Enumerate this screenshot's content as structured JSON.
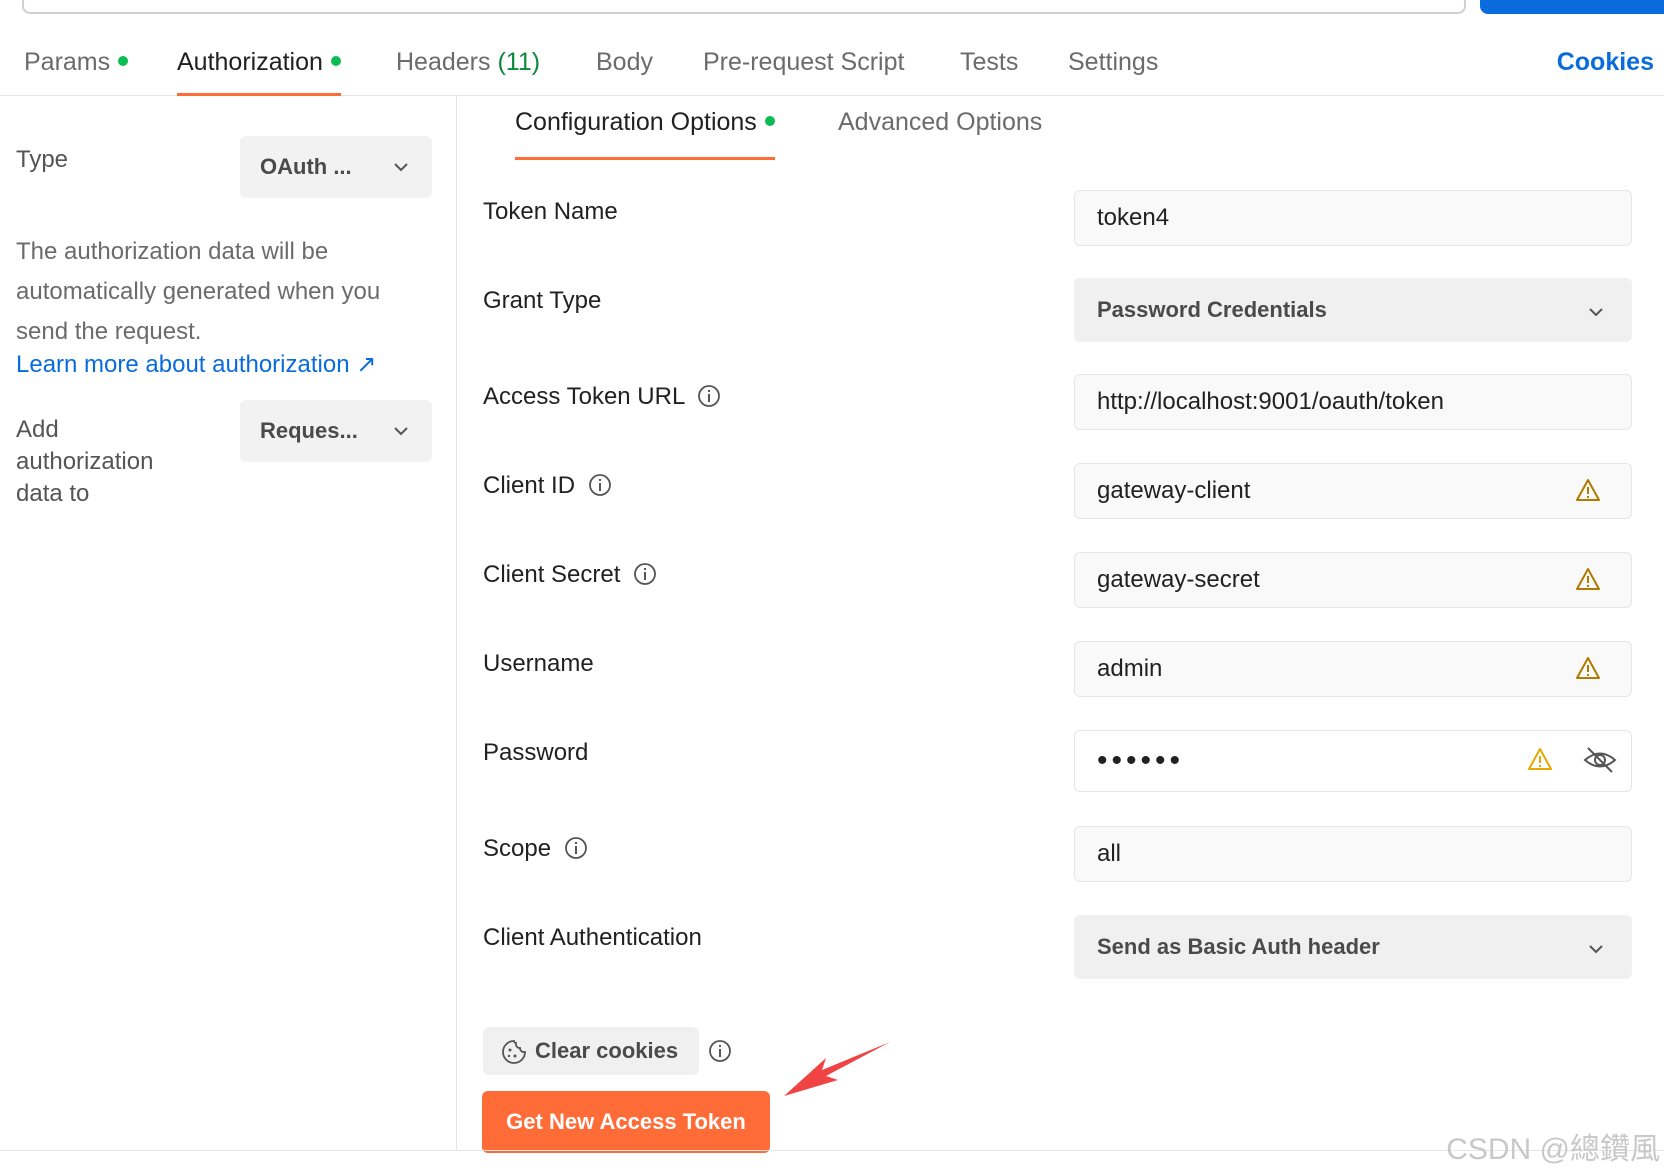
{
  "request_tabs": {
    "params": "Params",
    "authorization": "Authorization",
    "headers": "Headers",
    "headers_count": "(11)",
    "body": "Body",
    "pre_request": "Pre-request Script",
    "tests": "Tests",
    "settings": "Settings",
    "cookies": "Cookies"
  },
  "left": {
    "type_label": "Type",
    "type_value": "OAuth ...",
    "description": "The authorization data will be automatically generated when you send the request.",
    "learn_more": "Learn more about authorization ↗",
    "add_label": "Add authorization data to",
    "add_value": "Reques..."
  },
  "config": {
    "tab_config": "Configuration Options",
    "tab_advanced": "Advanced Options"
  },
  "fields": {
    "token_name": {
      "label": "Token Name",
      "value": "token4"
    },
    "grant_type": {
      "label": "Grant Type",
      "value": "Password Credentials"
    },
    "access_token_url": {
      "label": "Access Token URL",
      "value": "http://localhost:9001/oauth/token"
    },
    "client_id": {
      "label": "Client ID",
      "value": "gateway-client"
    },
    "client_secret": {
      "label": "Client Secret",
      "value": "gateway-secret"
    },
    "username": {
      "label": "Username",
      "value": "admin"
    },
    "password": {
      "label": "Password",
      "value": "••••••"
    },
    "scope": {
      "label": "Scope",
      "value": "all"
    },
    "client_auth": {
      "label": "Client Authentication",
      "value": "Send as Basic Auth header"
    }
  },
  "actions": {
    "clear_cookies": "Clear cookies",
    "get_token": "Get New Access Token"
  },
  "watermark": "CSDN @總鑽風",
  "colors": {
    "accent": "#ff6c37",
    "link": "#0a6cdc",
    "status_dot": "#0cbb52",
    "warning": "#b07a00",
    "arrow": "#f04444"
  }
}
